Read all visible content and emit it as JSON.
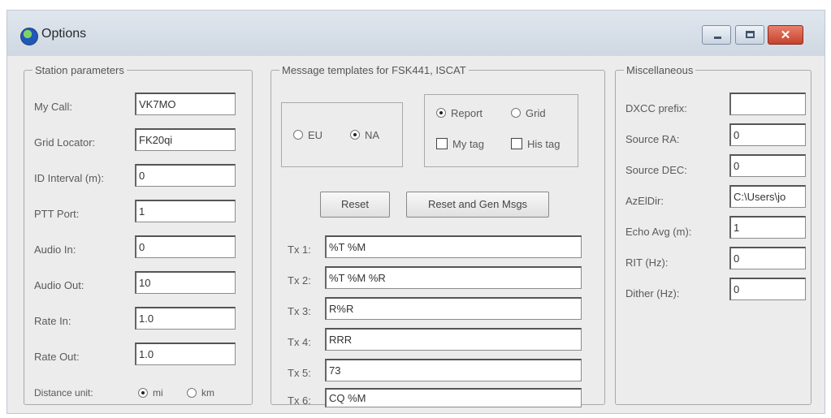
{
  "window": {
    "title": "Options",
    "controls": {
      "minimize": "minimize",
      "maximize": "maximize",
      "close": "✕"
    }
  },
  "station": {
    "legend": "Station parameters",
    "fields": [
      {
        "label": "My Call:",
        "value": "VK7MO"
      },
      {
        "label": "Grid Locator:",
        "value": "FK20qi"
      },
      {
        "label": "ID Interval (m):",
        "value": "0"
      },
      {
        "label": "PTT Port:",
        "value": "1"
      },
      {
        "label": "Audio In:",
        "value": "0"
      },
      {
        "label": "Audio Out:",
        "value": "10"
      },
      {
        "label": "Rate In:",
        "value": "1.0"
      },
      {
        "label": "Rate Out:",
        "value": "1.0"
      }
    ],
    "distance": {
      "label": "Distance unit:",
      "options": [
        "mi",
        "km"
      ],
      "selected": "mi"
    }
  },
  "templates": {
    "legend": "Message templates for FSK441, ISCAT",
    "region": {
      "options": [
        "EU",
        "NA"
      ],
      "selected": "NA"
    },
    "report_grid": {
      "options": [
        "Report",
        "Grid"
      ],
      "selected": "Report"
    },
    "tags": [
      {
        "label": "My tag",
        "checked": false
      },
      {
        "label": "His tag",
        "checked": false
      }
    ],
    "reset_label": "Reset",
    "reset_gen_label": "Reset and Gen Msgs",
    "tx": [
      {
        "label": "Tx 1:",
        "value": "%T %M"
      },
      {
        "label": "Tx 2:",
        "value": "%T %M %R"
      },
      {
        "label": "Tx 3:",
        "value": "R%R"
      },
      {
        "label": "Tx 4:",
        "value": "RRR"
      },
      {
        "label": "Tx 5:",
        "value": "73"
      },
      {
        "label": "Tx 6:",
        "value": "CQ %M"
      }
    ]
  },
  "misc": {
    "legend": "Miscellaneous",
    "fields": [
      {
        "label": "DXCC prefix:",
        "value": ""
      },
      {
        "label": "Source RA:",
        "value": "0"
      },
      {
        "label": "Source DEC:",
        "value": "0"
      },
      {
        "label": "AzElDir:",
        "value": "C:\\Users\\jo"
      },
      {
        "label": "Echo Avg (m):",
        "value": "1"
      },
      {
        "label": "RIT (Hz):",
        "value": "0"
      },
      {
        "label": "Dither (Hz):",
        "value": "0"
      }
    ]
  }
}
